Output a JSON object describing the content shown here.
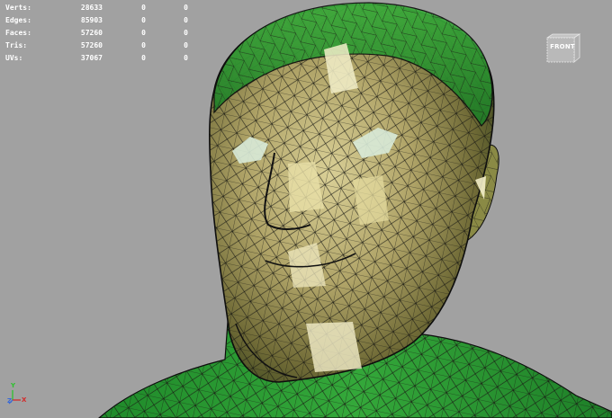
{
  "hud": {
    "rows": [
      {
        "label": "Verts:",
        "v1": "28633",
        "v2": "0",
        "v3": "0"
      },
      {
        "label": "Edges:",
        "v1": "85903",
        "v2": "0",
        "v3": "0"
      },
      {
        "label": "Faces:",
        "v1": "57260",
        "v2": "0",
        "v3": "0"
      },
      {
        "label": "Tris:",
        "v1": "57260",
        "v2": "0",
        "v3": "0"
      },
      {
        "label": "UVs:",
        "v1": "37067",
        "v2": "0",
        "v3": "0"
      }
    ]
  },
  "viewcube": {
    "label": "FRONT",
    "icon": "viewcube-icon"
  },
  "axis": {
    "y": "Y",
    "z": "Z",
    "x": "X"
  },
  "colors": {
    "background": "#a1a1a1",
    "mesh_green": "#2e9a34",
    "mesh_skin": "#b3a86a",
    "wire": "#1a1a14",
    "axis_x": "#d42a2a",
    "axis_y": "#2ec22e",
    "axis_z": "#3a6ad6"
  }
}
